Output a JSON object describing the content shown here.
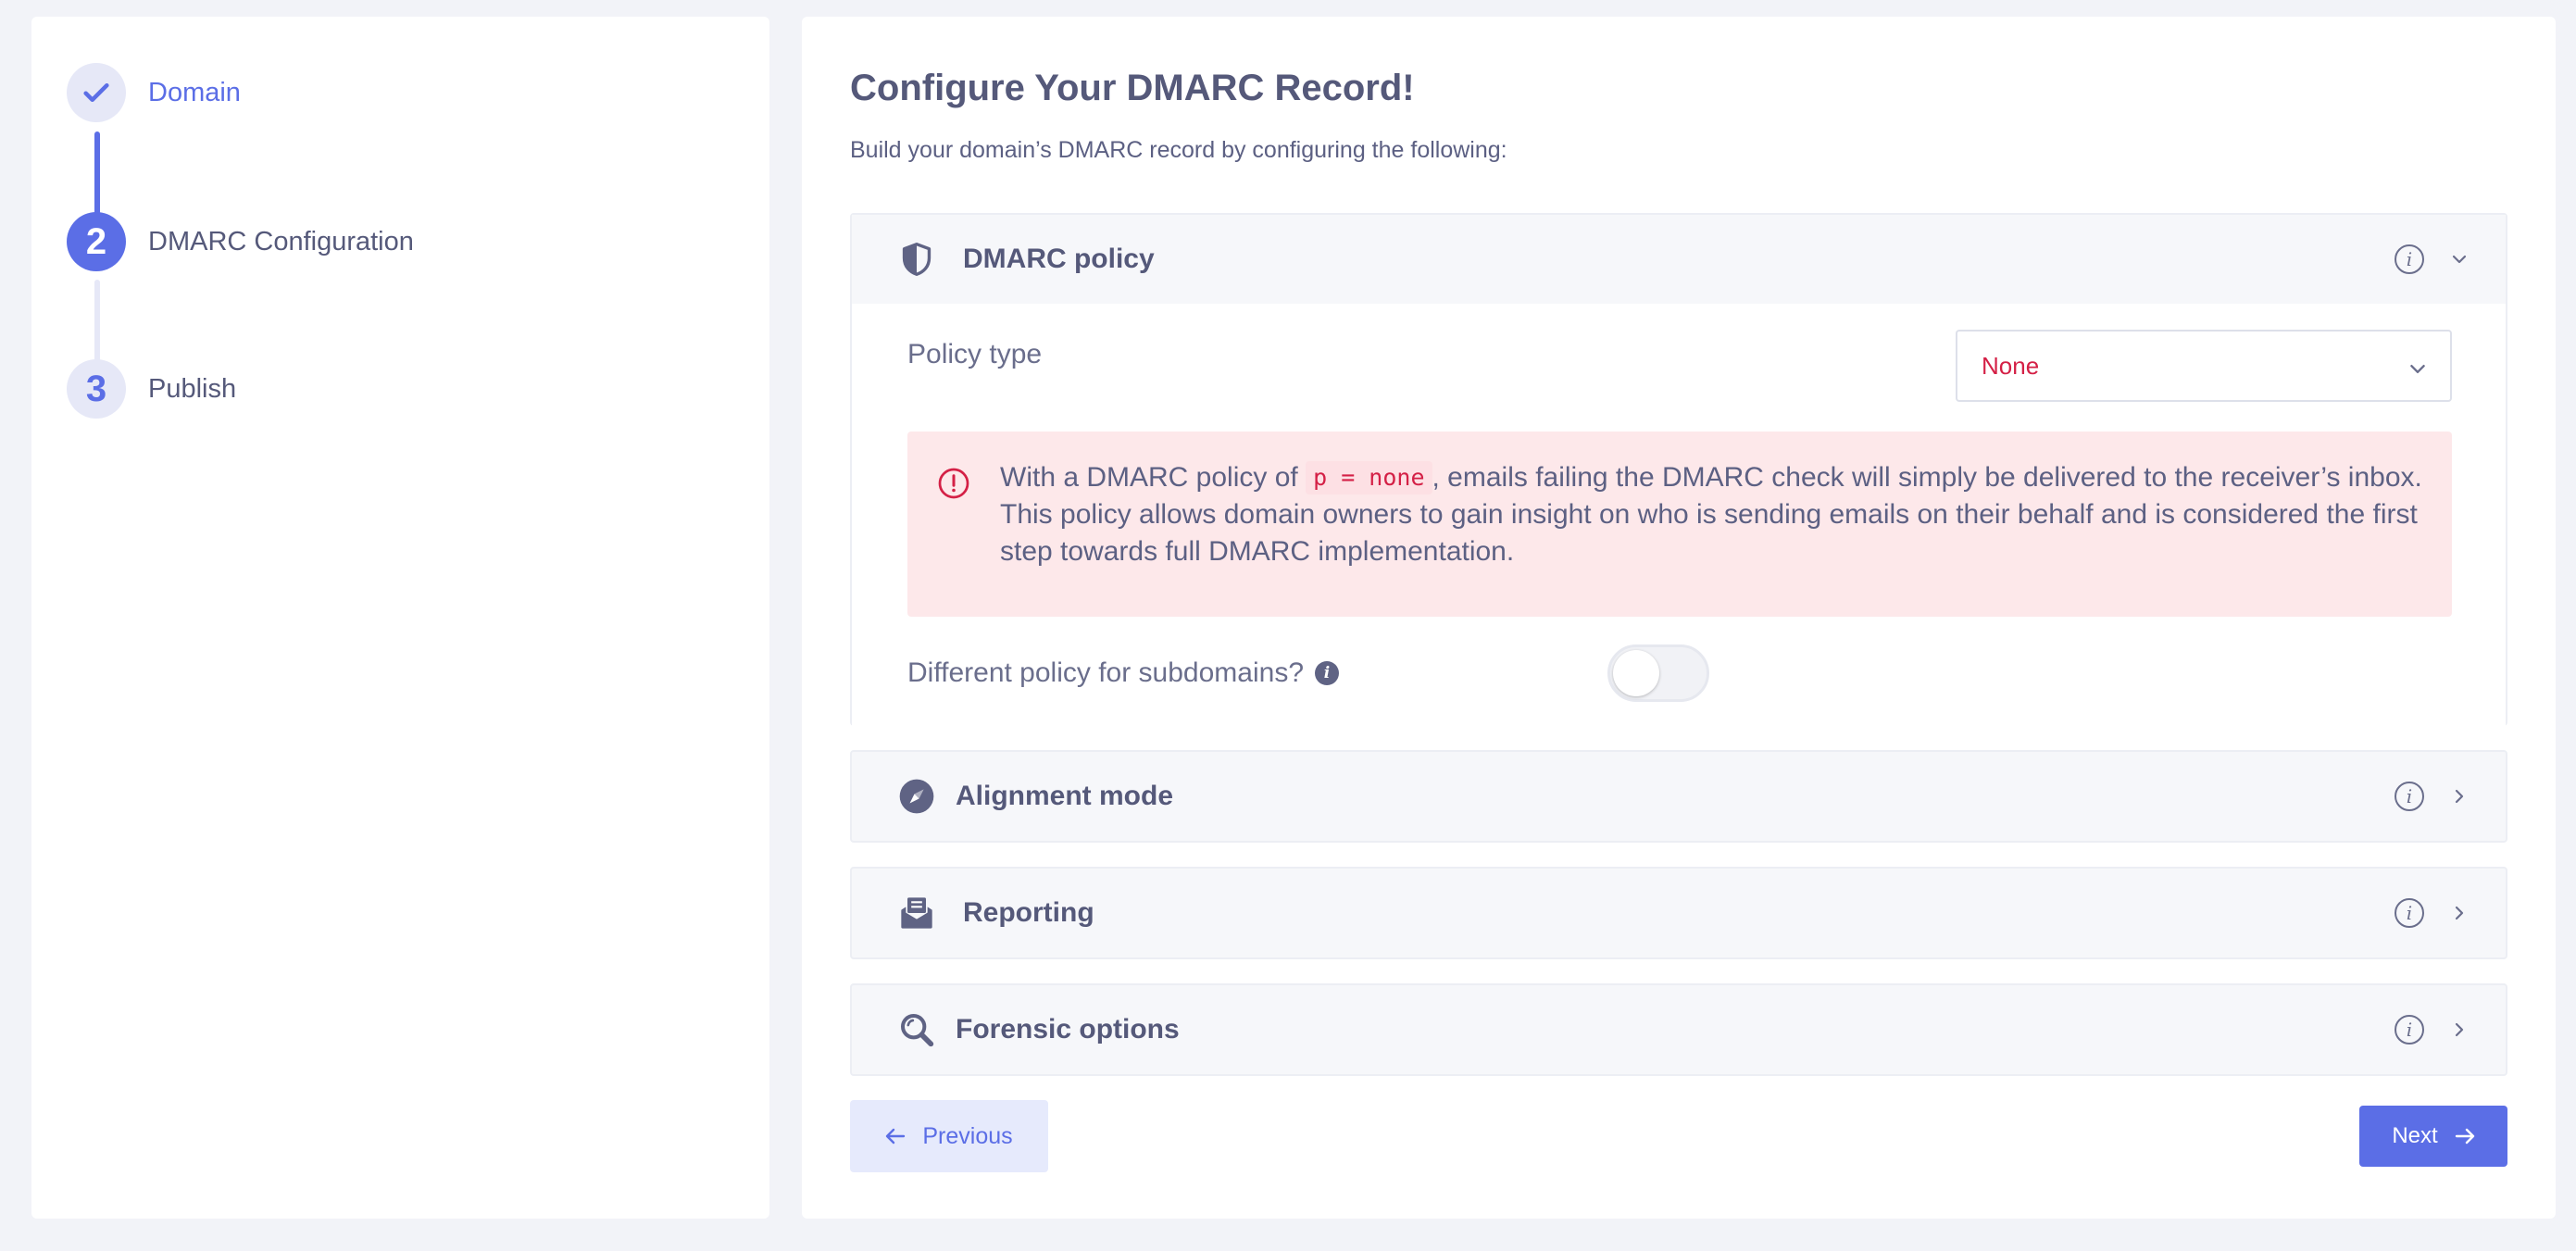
{
  "steps": [
    {
      "label": "Domain",
      "state": "done",
      "marker_icon": "check-icon"
    },
    {
      "label": "DMARC Configuration",
      "state": "active",
      "number": "2"
    },
    {
      "label": "Publish",
      "state": "pending",
      "number": "3"
    }
  ],
  "page": {
    "title": "Configure Your DMARC Record!",
    "subtitle": "Build your domain’s DMARC record by configuring the following:"
  },
  "panels": {
    "policy": {
      "title": "DMARC policy",
      "icon": "shield-icon",
      "expanded": true,
      "policy_type_label": "Policy type",
      "policy_type_value": "None",
      "alert": {
        "before": "With a DMARC policy of",
        "code": "p = none",
        "after": ", emails failing the DMARC check will simply be delivered to the receiver’s inbox. This policy allows domain owners to gain insight on who is sending emails on their behalf and is considered the first step towards full DMARC implementation."
      },
      "subdomain_label": "Different policy for subdomains?",
      "subdomain_toggle_on": false
    },
    "alignment": {
      "title": "Alignment mode",
      "icon": "compass-icon",
      "expanded": false
    },
    "reporting": {
      "title": "Reporting",
      "icon": "envelope-open-icon",
      "expanded": false
    },
    "forensic": {
      "title": "Forensic options",
      "icon": "magnifier-icon",
      "expanded": false
    }
  },
  "buttons": {
    "previous": "Previous",
    "next": "Next"
  },
  "colors": {
    "accent": "#5b6ee6",
    "alert_bg": "#fde8ea",
    "alert_red": "#d42046",
    "text": "#55597a"
  }
}
